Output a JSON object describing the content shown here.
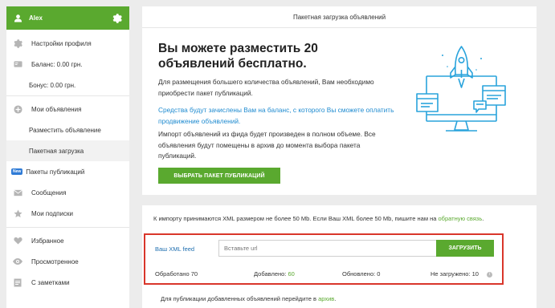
{
  "sidebar": {
    "user_name": "Alex",
    "items": [
      {
        "label": "Настройки профиля",
        "icon": "gear-icon"
      },
      {
        "label": "Баланс: 0.00 грн.",
        "icon": "wallet-icon"
      },
      {
        "label": "Бонус: 0.00 грн."
      },
      {
        "label": "Мои объявления",
        "icon": "plus-circle-icon"
      },
      {
        "label": "Разместить объявление"
      },
      {
        "label": "Пакетная загрузка"
      },
      {
        "label": "Пакеты публикаций",
        "badge": "New"
      },
      {
        "label": "Сообщения",
        "icon": "envelope-icon"
      },
      {
        "label": "Мои подписки",
        "icon": "star-icon"
      },
      {
        "label": "Избранное",
        "icon": "heart-icon"
      },
      {
        "label": "Просмотренное",
        "icon": "eye-icon"
      },
      {
        "label": "С заметками",
        "icon": "note-icon"
      }
    ]
  },
  "top_panel": {
    "title": "Пакетная загрузка объявлений",
    "hero": "Вы можете разместить 20 объявлений бесплатно.",
    "p1": "Для размещения большего количества объявлений, Вам необходимо приобрести пакет публикаций.",
    "p2": "Средства будут зачислены Вам на баланс, с которого Вы сможете оплатить продвижение объявлений.",
    "p3": "Импорт объявлений из фида будет произведен в полном объеме. Все объявления будут помещены в архив до момента выбора пакета публикаций.",
    "buy_button": "ВЫБРАТЬ ПАКЕТ ПУБЛИКАЦИЙ"
  },
  "bottom_panel": {
    "info_text": "К импорту принимаются XML размером не более 50 Mb. Если Ваш XML более 50 Mb, пишите нам на",
    "info_link": "обратную связь",
    "info_end": ".",
    "feed_label": "Ваш XML feed",
    "input_placeholder": "Вставьте url",
    "upload_button": "ЗАГРУЗИТЬ",
    "stats": {
      "processed_label": "Обработано",
      "processed": "70",
      "added_label": "Добавлено:",
      "added": "60",
      "updated_label": "Обновлено:",
      "updated": "0",
      "failed_label": "Не загружено:",
      "failed": "10"
    },
    "archive_text": "Для публикации добавленных объявлений перейдите в",
    "archive_link": "архив",
    "archive_end": "."
  },
  "colors": {
    "green": "#5aa92f",
    "blue_link": "#1f8bd0",
    "highlight_border": "#d9362b",
    "illustration_blue": "#29a3dc"
  }
}
